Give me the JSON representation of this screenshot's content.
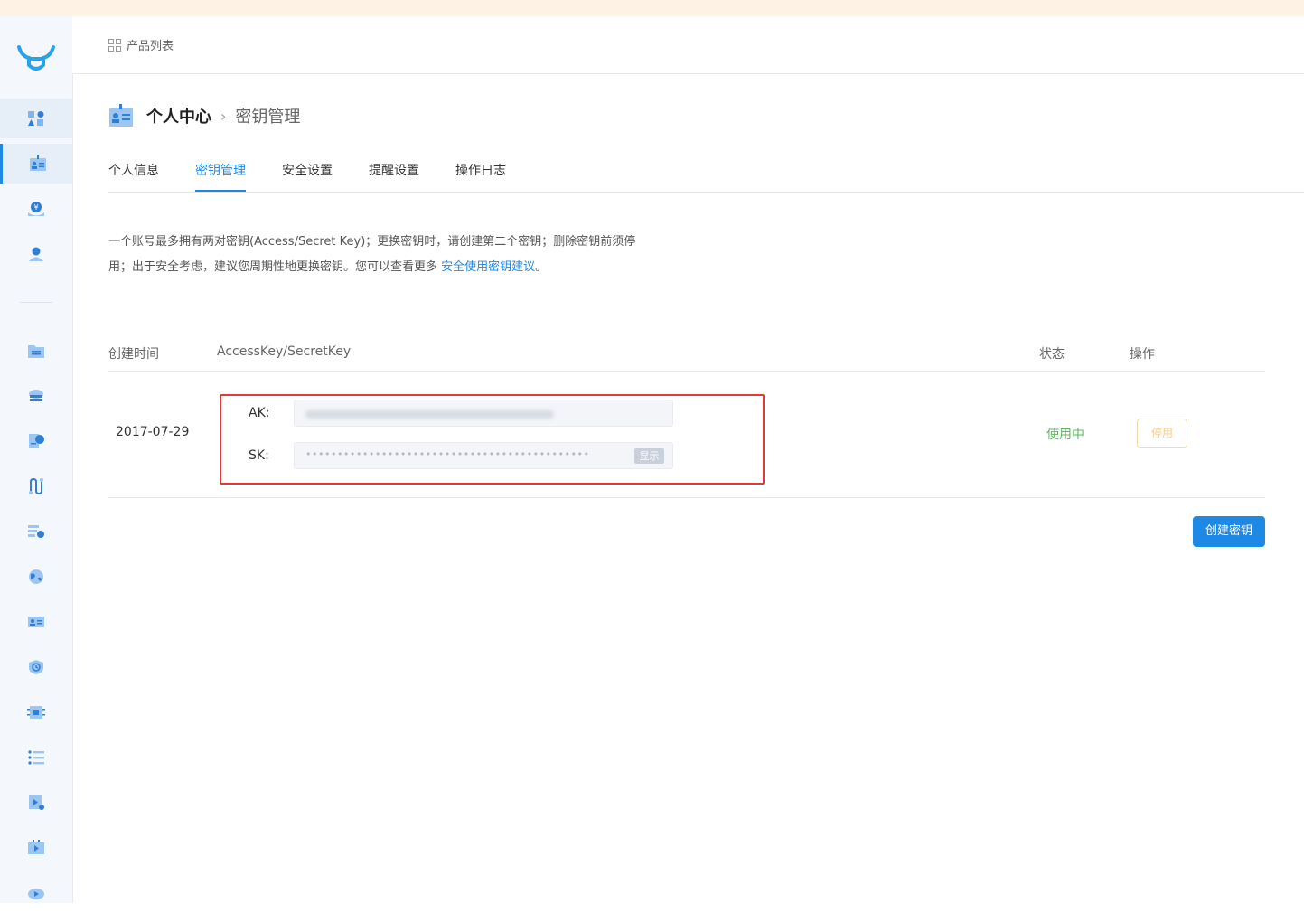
{
  "header": {
    "breadcrumb": "产品列表"
  },
  "page": {
    "title": "个人中心",
    "separator": "›",
    "subtitle": "密钥管理"
  },
  "tabs": [
    {
      "label": "个人信息",
      "active": false
    },
    {
      "label": "密钥管理",
      "active": true
    },
    {
      "label": "安全设置",
      "active": false
    },
    {
      "label": "提醒设置",
      "active": false
    },
    {
      "label": "操作日志",
      "active": false
    }
  ],
  "description": {
    "line1": "一个账号最多拥有两对密钥(Access/Secret Key)；更换密钥时，请创建第二个密钥；删除密钥前须停",
    "line2_prefix": "用；出于安全考虑，建议您周期性地更换密钥。您可以查看更多",
    "link": "安全使用密钥建议",
    "line2_suffix": "。"
  },
  "table": {
    "headers": {
      "created": "创建时间",
      "keys": "AccessKey/SecretKey",
      "status": "状态",
      "action": "操作"
    },
    "rows": [
      {
        "created": "2017-07-29",
        "ak_label": "AK:",
        "sk_label": "SK:",
        "sk_masked": "•••••••••••••••••••••••••••••••••••••••••••••",
        "show_label": "显示",
        "status": "使用中",
        "disable_label": "停用"
      }
    ]
  },
  "actions": {
    "create_label": "创建密钥"
  },
  "colors": {
    "accent": "#1e88e5",
    "status_ok": "#5cb85c",
    "highlight_border": "#e53935",
    "warning_soft": "#f5cc8a"
  }
}
